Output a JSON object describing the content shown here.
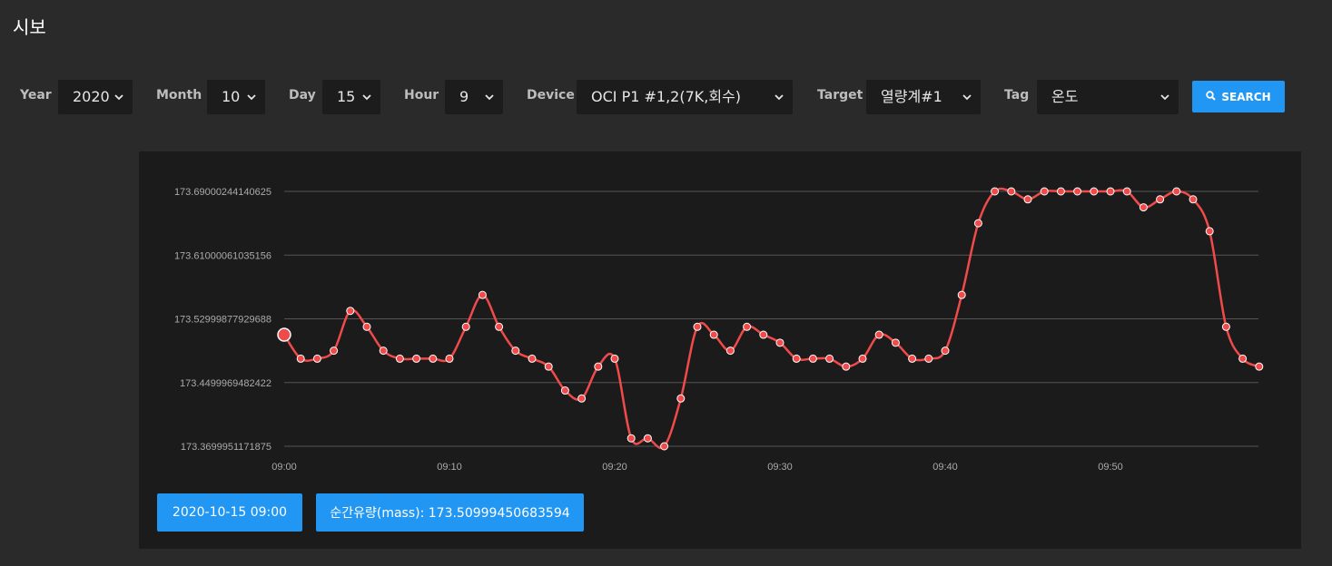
{
  "page": {
    "title": "시보"
  },
  "filters": [
    {
      "label": "Year",
      "value": "2020"
    },
    {
      "label": "Month",
      "value": "10"
    },
    {
      "label": "Day",
      "value": "15"
    },
    {
      "label": "Hour",
      "value": "9"
    },
    {
      "label": "Device",
      "value": "OCI P1 #1,2(7K,회수)"
    },
    {
      "label": "Target",
      "value": "열량계#1"
    },
    {
      "label": "Tag",
      "value": "온도"
    }
  ],
  "search": {
    "label": "SEARCH",
    "icon": "search-icon"
  },
  "colors": {
    "accent": "#2196f3",
    "line": "#f04a4a",
    "background": "#2a2a2a",
    "panel": "#1b1b1b"
  },
  "info": {
    "timestamp": "2020-10-15 09:00",
    "value_text": "순간유량(mass): 173.50999450683594"
  },
  "chart_data": {
    "type": "line",
    "x_ticks": [
      "09:00",
      "09:10",
      "09:20",
      "09:30",
      "09:40",
      "09:50"
    ],
    "y_ticks": [
      "173.3699951171875",
      "173.4499969482422",
      "173.52999877929688",
      "173.61000061035156",
      "173.69000244140625"
    ],
    "ylim": [
      173.3699951171875,
      173.69000244140625
    ],
    "grid": true,
    "highlight_index": 0,
    "x_minutes": [
      0,
      1,
      2,
      3,
      4,
      5,
      6,
      7,
      8,
      9,
      10,
      11,
      12,
      13,
      14,
      15,
      16,
      17,
      18,
      19,
      20,
      21,
      22,
      23,
      24,
      25,
      26,
      27,
      28,
      29,
      30,
      31,
      32,
      33,
      34,
      35,
      36,
      37,
      38,
      39,
      40,
      41,
      42,
      43,
      44,
      45,
      46,
      47,
      48,
      49,
      50,
      51,
      52,
      53,
      54,
      55,
      56,
      57,
      58,
      59
    ],
    "values": [
      173.51,
      173.48,
      173.48,
      173.49,
      173.54,
      173.52,
      173.49,
      173.48,
      173.48,
      173.48,
      173.48,
      173.52,
      173.56,
      173.52,
      173.49,
      173.48,
      173.47,
      173.44,
      173.43,
      173.47,
      173.48,
      173.38,
      173.38,
      173.37,
      173.43,
      173.52,
      173.51,
      173.49,
      173.52,
      173.51,
      173.5,
      173.48,
      173.48,
      173.48,
      173.47,
      173.48,
      173.51,
      173.5,
      173.48,
      173.48,
      173.49,
      173.56,
      173.65,
      173.69,
      173.69,
      173.68,
      173.69,
      173.69,
      173.69,
      173.69,
      173.69,
      173.69,
      173.67,
      173.68,
      173.69,
      173.68,
      173.64,
      173.52,
      173.48,
      173.47
    ]
  }
}
